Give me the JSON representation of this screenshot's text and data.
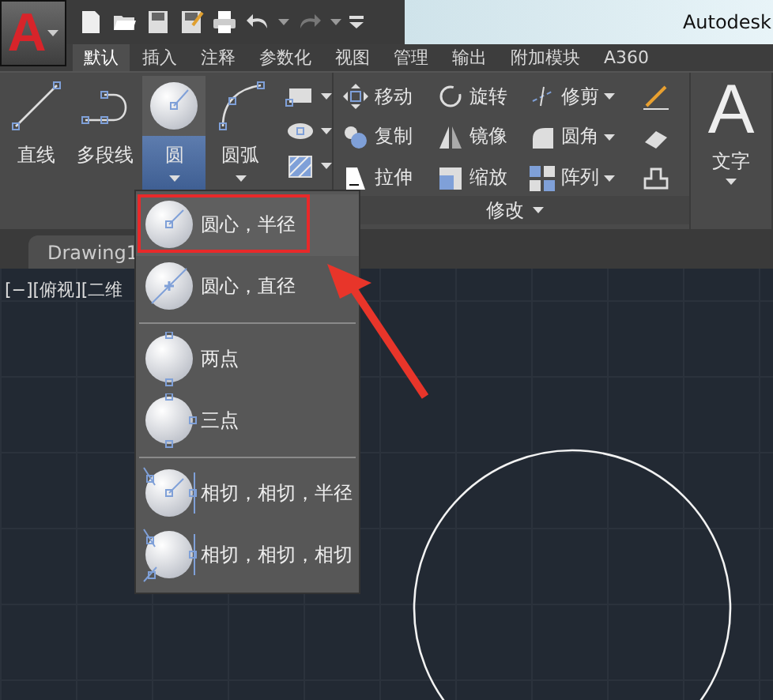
{
  "app_button": {
    "glyph": "A"
  },
  "title_bar": {
    "title": "Autodesk"
  },
  "tabs": [
    {
      "label": "默认",
      "selected": true
    },
    {
      "label": "插入",
      "selected": false
    },
    {
      "label": "注释",
      "selected": false
    },
    {
      "label": "参数化",
      "selected": false
    },
    {
      "label": "视图",
      "selected": false
    },
    {
      "label": "管理",
      "selected": false
    },
    {
      "label": "输出",
      "selected": false
    },
    {
      "label": "附加模块",
      "selected": false
    },
    {
      "label": "A360",
      "selected": false
    }
  ],
  "draw_tools": [
    {
      "label": "直线",
      "kind": "line",
      "selected": false
    },
    {
      "label": "多段线",
      "kind": "polyline",
      "selected": false
    },
    {
      "label": "圆",
      "kind": "circle",
      "selected": true
    },
    {
      "label": "圆弧",
      "kind": "arc",
      "selected": false
    }
  ],
  "modify_rows": [
    [
      {
        "label": "移动",
        "kind": "move",
        "dropdown": false
      },
      {
        "label": "旋转",
        "kind": "rotate",
        "dropdown": false
      },
      {
        "label": "修剪",
        "kind": "trim",
        "dropdown": true
      }
    ],
    [
      {
        "label": "复制",
        "kind": "copy",
        "dropdown": false
      },
      {
        "label": "镜像",
        "kind": "mirror",
        "dropdown": false
      },
      {
        "label": "圆角",
        "kind": "fillet",
        "dropdown": true
      }
    ],
    [
      {
        "label": "拉伸",
        "kind": "stretch",
        "dropdown": false
      },
      {
        "label": "缩放",
        "kind": "scale",
        "dropdown": false
      },
      {
        "label": "阵列",
        "kind": "array",
        "dropdown": true
      }
    ]
  ],
  "modify_panel": {
    "label": "修改"
  },
  "text_tool": {
    "glyph": "A",
    "label": "文字"
  },
  "file_tabs": [
    {
      "label": "Drawing1",
      "selected": true
    }
  ],
  "viewport_label": "[−][俯视][二维",
  "circle_menu": {
    "groups": [
      [
        {
          "label": "圆心，半径",
          "kind": "center-radius",
          "highlighted": true
        },
        {
          "label": "圆心，直径",
          "kind": "center-diameter",
          "highlighted": false
        }
      ],
      [
        {
          "label": "两点",
          "kind": "two-point",
          "highlighted": false
        },
        {
          "label": "三点",
          "kind": "three-point",
          "highlighted": false
        }
      ],
      [
        {
          "label": "相切，相切，半径",
          "kind": "tan-tan-radius",
          "highlighted": false
        },
        {
          "label": "相切，相切，相切",
          "kind": "tan-tan-tan",
          "highlighted": false
        }
      ]
    ]
  }
}
